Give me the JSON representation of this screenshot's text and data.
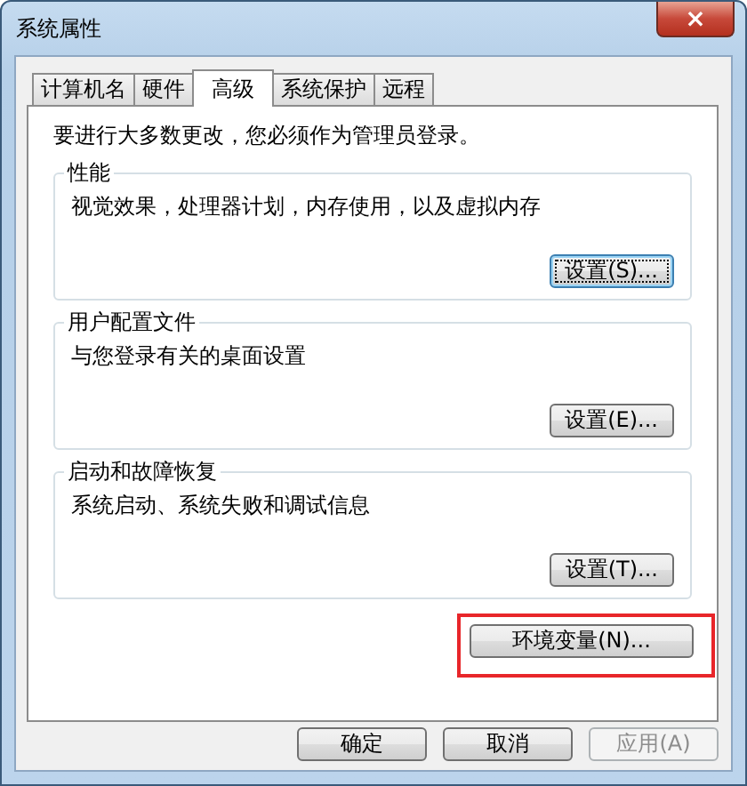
{
  "window": {
    "title": "系统属性",
    "close": "×"
  },
  "tabs": [
    {
      "label": "计算机名",
      "selected": false
    },
    {
      "label": "硬件",
      "selected": false
    },
    {
      "label": "高级",
      "selected": true
    },
    {
      "label": "系统保护",
      "selected": false
    },
    {
      "label": "远程",
      "selected": false
    }
  ],
  "notice": "要进行大多数更改，您必须作为管理员登录。",
  "groups": [
    {
      "title": "性能",
      "description": "视觉效果，处理器计划，内存使用，以及虚拟内存",
      "button": {
        "label": "设置(S)...",
        "focused": true
      }
    },
    {
      "title": "用户配置文件",
      "description": "与您登录有关的桌面设置",
      "button": {
        "label": "设置(E)...",
        "focused": false
      }
    },
    {
      "title": "启动和故障恢复",
      "description": "系统启动、系统失败和调试信息",
      "button": {
        "label": "设置(T)...",
        "focused": false
      }
    }
  ],
  "environment_button": {
    "label": "环境变量(N)...",
    "highlighted": true
  },
  "dialog_buttons": [
    {
      "label": "确定",
      "disabled": false
    },
    {
      "label": "取消",
      "disabled": false
    },
    {
      "label": "应用(A)",
      "disabled": true
    }
  ]
}
